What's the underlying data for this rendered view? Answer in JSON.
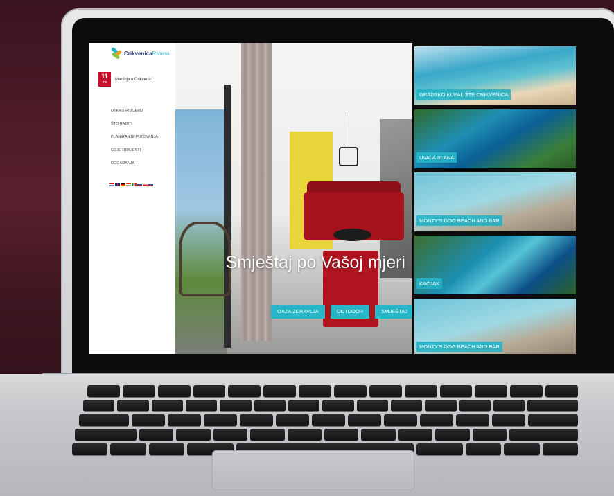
{
  "site": {
    "logo": {
      "brand": "Crikvenica",
      "sub": "Riviera"
    },
    "weather": {
      "temperature": "11",
      "unit": "ms",
      "location": "Martinja u Crikvenici"
    },
    "nav": [
      "OTKRIJ RIVIJERU",
      "ŠTO RADITI",
      "PLANIRANJE PUTOVANJA",
      "GDJE ODSJESTI",
      "DOGAĐANJA"
    ],
    "languages": [
      "hr",
      "en",
      "de",
      "hu",
      "it",
      "si",
      "cz",
      "sk"
    ],
    "hero": {
      "title": "Smještaj po Vašoj mjeri",
      "buttons": [
        "OAZA ZDRAVLJA",
        "OUTDOOR",
        "SMJEŠTAJ"
      ]
    },
    "tiles": [
      {
        "label": "GRADSKO KUPALIŠTE CRIKVENICA"
      },
      {
        "label": "UVALA SLANA"
      },
      {
        "label": "MONTY'S DOG BEACH AND BAR"
      },
      {
        "label": "KAČJAK"
      },
      {
        "label": "MONTY'S DOG BEACH AND BAR"
      }
    ]
  },
  "colors": {
    "accent": "#27b7c9",
    "badge": "#c8102e",
    "brand": "#2a3d7a"
  }
}
